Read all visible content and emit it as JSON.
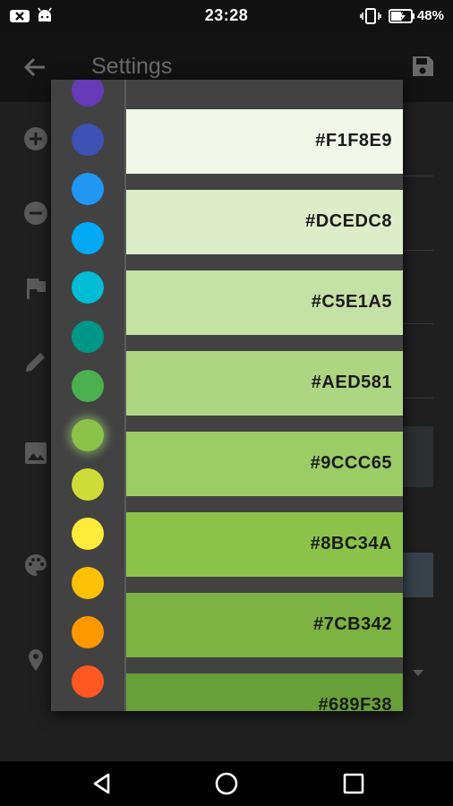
{
  "status_bar": {
    "time": "23:28",
    "battery_percent": "48%"
  },
  "app_bar": {
    "title": "Settings"
  },
  "palette": [
    {
      "name": "deep-purple",
      "color": "#673AB7"
    },
    {
      "name": "indigo",
      "color": "#3F51B5"
    },
    {
      "name": "blue",
      "color": "#2196F3"
    },
    {
      "name": "light-blue",
      "color": "#03A9F4"
    },
    {
      "name": "cyan",
      "color": "#00BCD4"
    },
    {
      "name": "teal",
      "color": "#009688"
    },
    {
      "name": "green",
      "color": "#4CAF50"
    },
    {
      "name": "light-green",
      "color": "#8BC34A",
      "selected": true
    },
    {
      "name": "lime",
      "color": "#CDDC39"
    },
    {
      "name": "yellow",
      "color": "#FFEB3B"
    },
    {
      "name": "amber",
      "color": "#FFC107"
    },
    {
      "name": "orange",
      "color": "#FF9800"
    },
    {
      "name": "deep-orange",
      "color": "#FF5722"
    }
  ],
  "shades": [
    {
      "hex": "#F1F8E9"
    },
    {
      "hex": "#DCEDC8"
    },
    {
      "hex": "#C5E1A5"
    },
    {
      "hex": "#AED581"
    },
    {
      "hex": "#9CCC65"
    },
    {
      "hex": "#8BC34A"
    },
    {
      "hex": "#7CB342"
    },
    {
      "hex": "#689F38"
    }
  ]
}
